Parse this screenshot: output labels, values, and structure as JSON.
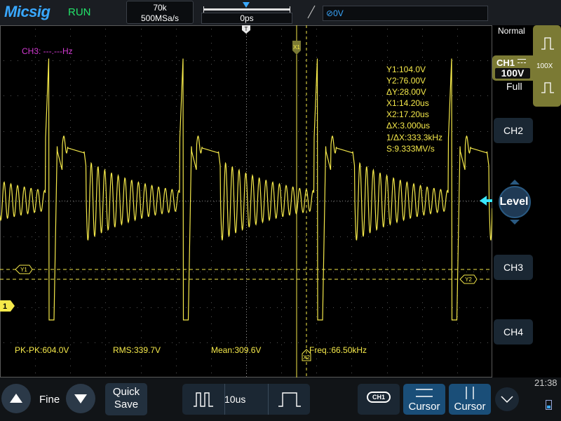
{
  "app": {
    "brand": "Micsig",
    "run_state": "RUN"
  },
  "acquisition": {
    "memory_depth": "70k",
    "sample_rate": "500MSa/s"
  },
  "timebase": {
    "horizontal_position": "0ps",
    "scale": "10us"
  },
  "trigger": {
    "level_text": "0V",
    "mode": "Normal",
    "edge": "rising"
  },
  "channel1": {
    "label": "CH1",
    "scale": "100V",
    "coupling_icon": "dc-coupling-icon",
    "probe_ratio": "100X",
    "bandwidth": "Full",
    "marker": "1",
    "color": "#f5e94a"
  },
  "channel3": {
    "freq_readout": "CH3: ---.---Hz",
    "color": "#d23ad2"
  },
  "cursors": {
    "x1_tag": "X1",
    "x2_tag": "X2",
    "y1_tag": "Y1",
    "y2_tag": "Y2",
    "readout": [
      "Y1:104.0V",
      "Y2:76.00V",
      "ΔY:28.00V",
      "X1:14.20us",
      "X2:17.20us",
      "ΔX:3.000us",
      "1/ΔX:333.3kHz",
      "S:9.333MV/s"
    ]
  },
  "measurements": {
    "pk_pk": "PK-PK:604.0V",
    "rms": "RMS:339.7V",
    "mean": "Mean:309.6V",
    "freq": "Freq.:66.50kHz"
  },
  "right_panel": {
    "ch2": "CH2",
    "ch3": "CH3",
    "ch4": "CH4",
    "level": "Level"
  },
  "bottom": {
    "adjust_mode": "Fine",
    "quick_save_1": "Quick",
    "quick_save_2": "Save",
    "ch_select": "CH1",
    "cursor_1": "Cursor",
    "cursor_2": "Cursor",
    "clock": "21:38"
  },
  "colors": {
    "accent": "#39a8ff",
    "run": "#22e36a",
    "trace": "#f5e94a",
    "grid": "#5a5a5a",
    "button": "#1a4e78"
  }
}
